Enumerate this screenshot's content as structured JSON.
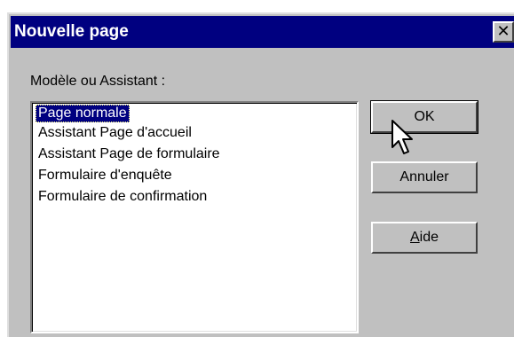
{
  "dialog": {
    "title": "Nouvelle page",
    "close_glyph": "✕",
    "group_label": "Modèle ou Assistant :",
    "items": [
      {
        "label": "Page normale",
        "selected": true
      },
      {
        "label": "Assistant Page d'accueil",
        "selected": false
      },
      {
        "label": "Assistant Page de formulaire",
        "selected": false
      },
      {
        "label": "Formulaire d'enquête",
        "selected": false
      },
      {
        "label": "Formulaire de confirmation",
        "selected": false
      }
    ],
    "buttons": {
      "ok": "OK",
      "cancel": "Annuler",
      "help_first": "A",
      "help_rest": "ide"
    }
  }
}
